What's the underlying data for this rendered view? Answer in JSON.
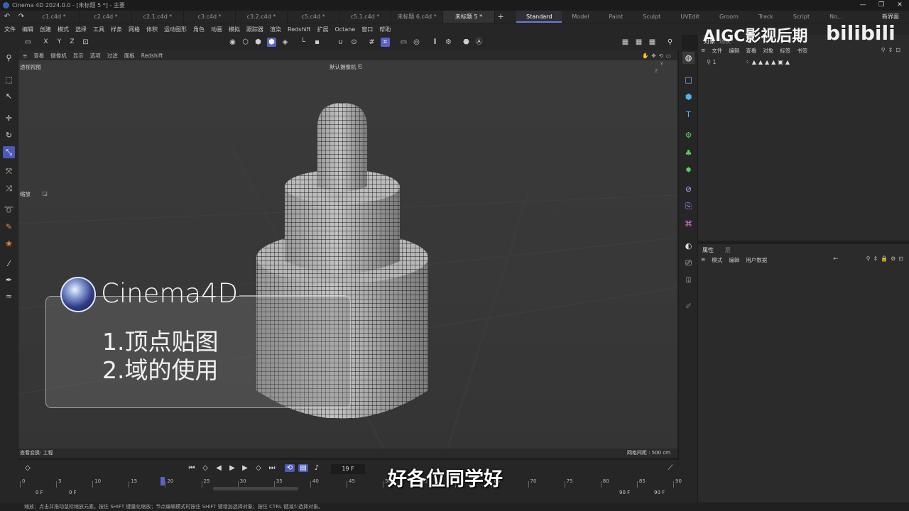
{
  "window": {
    "title": "Cinema 4D 2024.0.0 - [未标题 5 *] - 主要",
    "controls": [
      "—",
      "❐",
      "✕"
    ]
  },
  "file_tabs": [
    "c1.c4d *",
    "c2.c4d *",
    "c2.1.c4d *",
    "c3.c4d *",
    "c3.2.c4d *",
    "c5.c4d *",
    "c5.1.c4d *",
    "未标题 6.c4d *",
    "未标题 5 *"
  ],
  "active_file_tab": 8,
  "add_tab": "+",
  "layouts": [
    "Standard",
    "Model",
    "Paint",
    "Sculpt",
    "UVEdit",
    "Groom",
    "Track",
    "Script",
    "No..."
  ],
  "new_interface": "新界面",
  "menu": [
    "文件",
    "编辑",
    "创建",
    "模式",
    "选择",
    "工具",
    "样条",
    "网格",
    "体积",
    "运动图形",
    "角色",
    "动画",
    "模拟",
    "跟踪器",
    "渲染",
    "Redshift",
    "扩展",
    "Octane",
    "窗口",
    "帮助"
  ],
  "coords": {
    "x": "X",
    "y": "Y",
    "z": "Z"
  },
  "viewport_menu": [
    "查看",
    "摄像机",
    "显示",
    "选项",
    "过滤",
    "面板",
    "Redshift"
  ],
  "viewport": {
    "name": "透视视图",
    "camera": "默认摄像机",
    "zoom_label": "缩放",
    "axis_y": "Y",
    "axis_z": "Z",
    "status_left": "查看变换: 工程",
    "grid_spacing": "网格间距 : 500 cm"
  },
  "overlay": {
    "brand": "Cinema4D",
    "items": [
      "1.顶点贴图",
      "2.域的使用"
    ]
  },
  "object_panel": {
    "tabs": [
      "对象",
      "场次"
    ],
    "menu": [
      "文件",
      "编辑",
      "查看",
      "对象",
      "标签",
      "书签"
    ]
  },
  "attribute_panel": {
    "tabs": [
      "属性",
      "层"
    ],
    "menu": [
      "模式",
      "编辑",
      "用户数据"
    ]
  },
  "timeline": {
    "current_frame": "19 F",
    "start": "0 F",
    "start2": "0 F",
    "end": "90 F",
    "end2": "90 F",
    "ticks": [
      "0",
      "5",
      "10",
      "15",
      "20",
      "25",
      "30",
      "35",
      "40",
      "45",
      "50",
      "55",
      "60",
      "65",
      "70",
      "75",
      "80",
      "85",
      "90"
    ],
    "marker_value": "19"
  },
  "help_text": "缩放：点击并拖动鼠标缩放元素。按住 SHIFT 键量化缩放；节点编辑模式时按住 SHIFT 键增加选择对象；按住 CTRL 键减少选择对象。",
  "watermark": "AIGC影视后期",
  "bilibili": "bilibili",
  "subtitle": "好各位同学好",
  "colors": {
    "accent": "#5a63c6",
    "viewport_bg": "#383838",
    "panel_bg": "#2b2b2b"
  }
}
